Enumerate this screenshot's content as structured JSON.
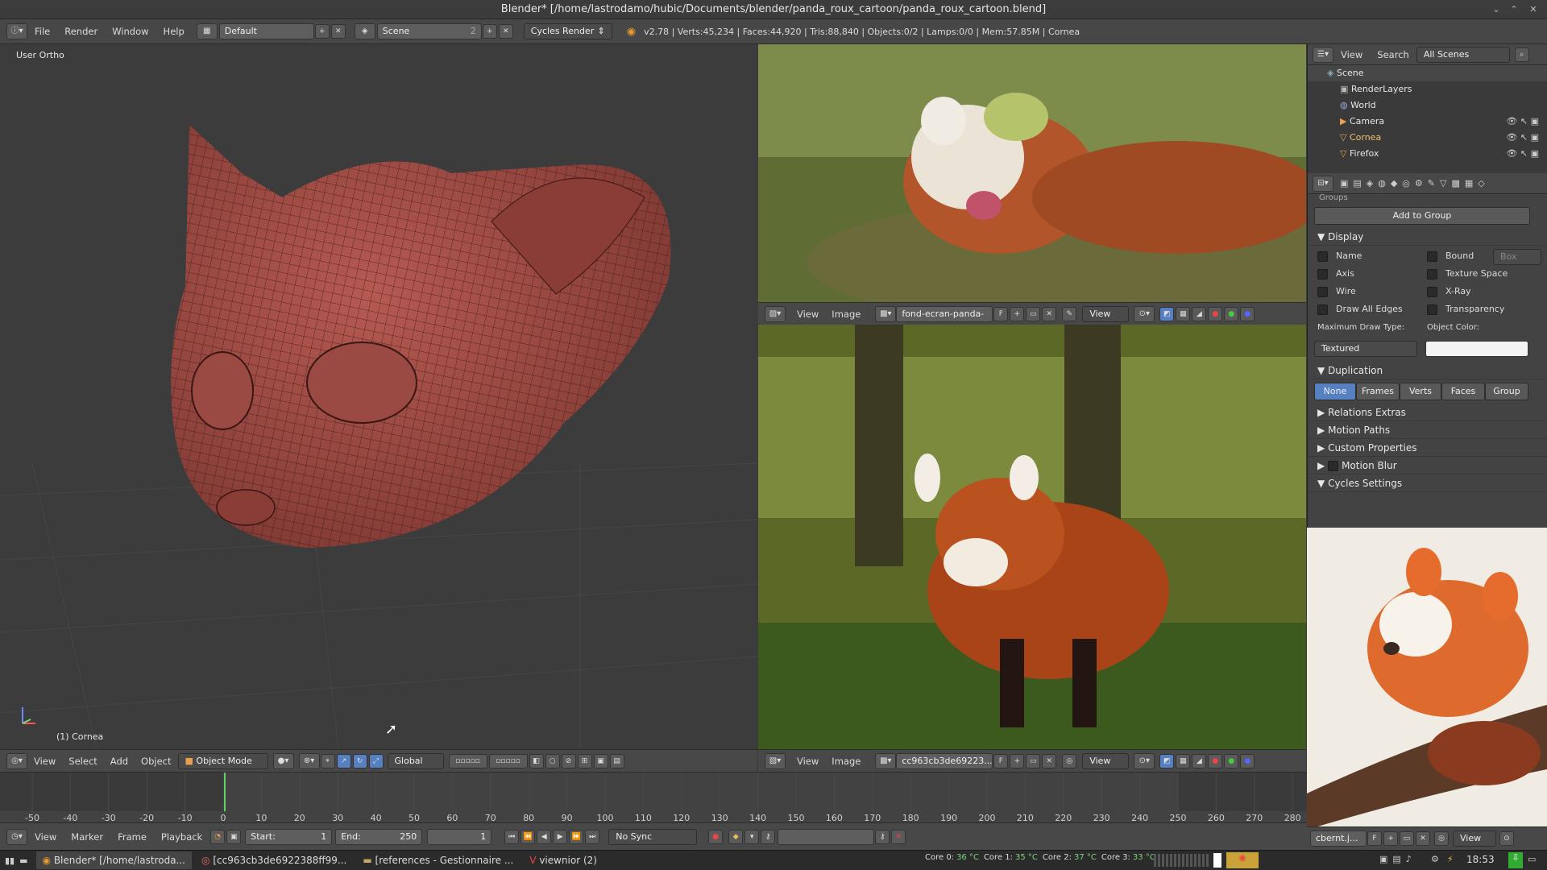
{
  "window": {
    "title": "Blender* [/home/lastrodamo/hubic/Documents/blender/panda_roux_cartoon/panda_roux_cartoon.blend]"
  },
  "info": {
    "menus": [
      "File",
      "Render",
      "Window",
      "Help"
    ],
    "layout": "Default",
    "scene": "Scene",
    "scene_users": "2",
    "engine": "Cycles Render",
    "stats": "v2.78 | Verts:45,234 | Faces:44,920 | Tris:88,840 | Objects:0/2 | Lamps:0/0 | Mem:57.85M | Cornea"
  },
  "viewport": {
    "view_label": "User Ortho",
    "object_label": "(1) Cornea",
    "menus": [
      "View",
      "Select",
      "Add",
      "Object"
    ],
    "mode": "Object Mode",
    "orientation": "Global"
  },
  "image_top": {
    "menus": [
      "View",
      "Image"
    ],
    "image_name": "fond-ecran-panda-ro...",
    "f": "F",
    "view": "View"
  },
  "image_mid": {
    "menus": [
      "View",
      "Image"
    ],
    "image_name": "cc963cb3de69223...",
    "f": "F",
    "view": "View"
  },
  "image_right": {
    "image_name": "cbernt.j...",
    "f": "F",
    "view": "View"
  },
  "outliner": {
    "menus": [
      "View",
      "Search"
    ],
    "filter": "All Scenes",
    "items": [
      {
        "label": "Scene"
      },
      {
        "label": "RenderLayers"
      },
      {
        "label": "World"
      },
      {
        "label": "Camera"
      },
      {
        "label": "Cornea"
      },
      {
        "label": "Firefox"
      }
    ]
  },
  "properties": {
    "groups_label": "Groups",
    "add_group": "Add to Group",
    "display": {
      "title": "Display",
      "name": "Name",
      "axis": "Axis",
      "wire": "Wire",
      "draw_all_edges": "Draw All Edges",
      "bound": "Bound",
      "bound_type": "Box",
      "texture_space": "Texture Space",
      "xray": "X-Ray",
      "transparency": "Transparency",
      "max_draw_label": "Maximum Draw Type:",
      "max_draw_value": "Textured",
      "object_color_label": "Object Color:"
    },
    "duplication": {
      "title": "Duplication",
      "options": [
        "None",
        "Frames",
        "Verts",
        "Faces",
        "Group"
      ]
    },
    "panels": [
      "Relations Extras",
      "Motion Paths",
      "Custom Properties",
      "Motion Blur",
      "Cycles Settings"
    ]
  },
  "timeline": {
    "ticks": [
      "-50",
      "-40",
      "-30",
      "-20",
      "-10",
      "0",
      "10",
      "20",
      "30",
      "40",
      "50",
      "60",
      "70",
      "80",
      "90",
      "100",
      "110",
      "120",
      "130",
      "140",
      "150",
      "160",
      "170",
      "180",
      "190",
      "200",
      "210",
      "220",
      "230",
      "240",
      "250",
      "260",
      "270",
      "280"
    ],
    "menus": [
      "View",
      "Marker",
      "Frame",
      "Playback"
    ],
    "start": "Start:",
    "start_val": "1",
    "end": "End:",
    "end_val": "250",
    "current": "1",
    "sync": "No Sync"
  },
  "taskbar": {
    "tasks": [
      "Blender* [/home/lastroda...",
      "[cc963cb3de6922388ff99...",
      "[references - Gestionnaire ...",
      "viewnior (2)"
    ],
    "cores": [
      {
        "label": "Core 0:",
        "temp": "36 °C"
      },
      {
        "label": "Core 1:",
        "temp": "35 °C"
      },
      {
        "label": "Core 2:",
        "temp": "37 °C"
      },
      {
        "label": "Core 3:",
        "temp": "33 °C"
      }
    ],
    "clock": "18:53"
  },
  "colors": {
    "accent": "#5680c2",
    "mesh": "#a8524b",
    "active_frame": "#5fd35f",
    "temp": "#7fd17f"
  }
}
